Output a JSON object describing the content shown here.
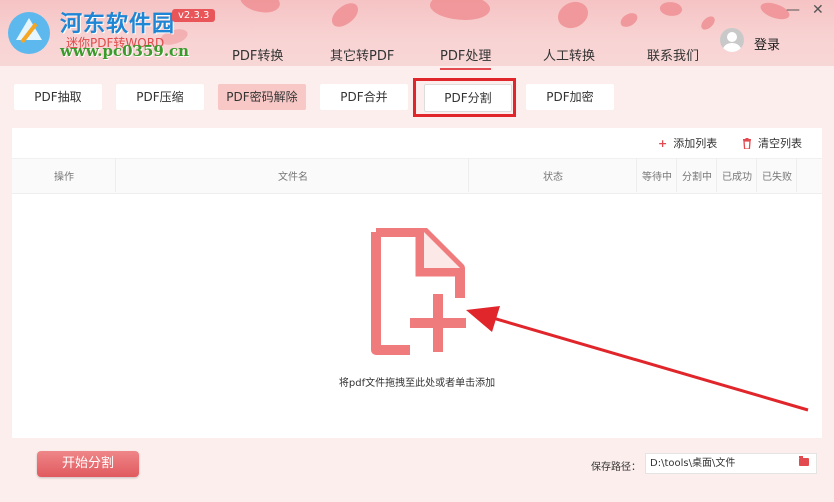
{
  "titlebar": {
    "watermark_title": "河东软件园",
    "app_subtitle": "迷你PDF转WORD",
    "watermark_url": "www.pc0359.cn",
    "version": "v2.3.3",
    "minimize_glyph": "—",
    "close_glyph": "✕"
  },
  "nav": {
    "items": [
      {
        "label": "PDF转换"
      },
      {
        "label": "其它转PDF"
      },
      {
        "label": "PDF处理"
      },
      {
        "label": "人工转换"
      },
      {
        "label": "联系我们"
      }
    ],
    "active": "PDF处理",
    "login_label": "登录"
  },
  "subtabs": {
    "items": [
      {
        "label": "PDF抽取"
      },
      {
        "label": "PDF压缩"
      },
      {
        "label": "PDF密码解除"
      },
      {
        "label": "PDF合并"
      },
      {
        "label": "PDF分割"
      },
      {
        "label": "PDF加密"
      }
    ],
    "selected": "PDF密码解除",
    "highlighted": "PDF分割"
  },
  "toolbar": {
    "add_label": "添加列表",
    "add_icon": "plus-icon",
    "clear_label": "清空列表",
    "clear_icon": "trash-icon"
  },
  "table": {
    "columns": [
      "操作",
      "文件名",
      "状态",
      "等待中",
      "分割中",
      "已成功",
      "已失败"
    ]
  },
  "dropzone": {
    "icon": "add-file-icon",
    "hint": "将pdf文件拖拽至此处或者单击添加"
  },
  "footer": {
    "start_label": "开始分割",
    "save_path_label": "保存路径：",
    "save_path_value": "D:\\tools\\桌面\\文件",
    "folder_icon": "folder-icon"
  },
  "colors": {
    "accent": "#e24a4f",
    "annotation_red": "#e0262b",
    "icon_fill": "#f07b7d"
  }
}
